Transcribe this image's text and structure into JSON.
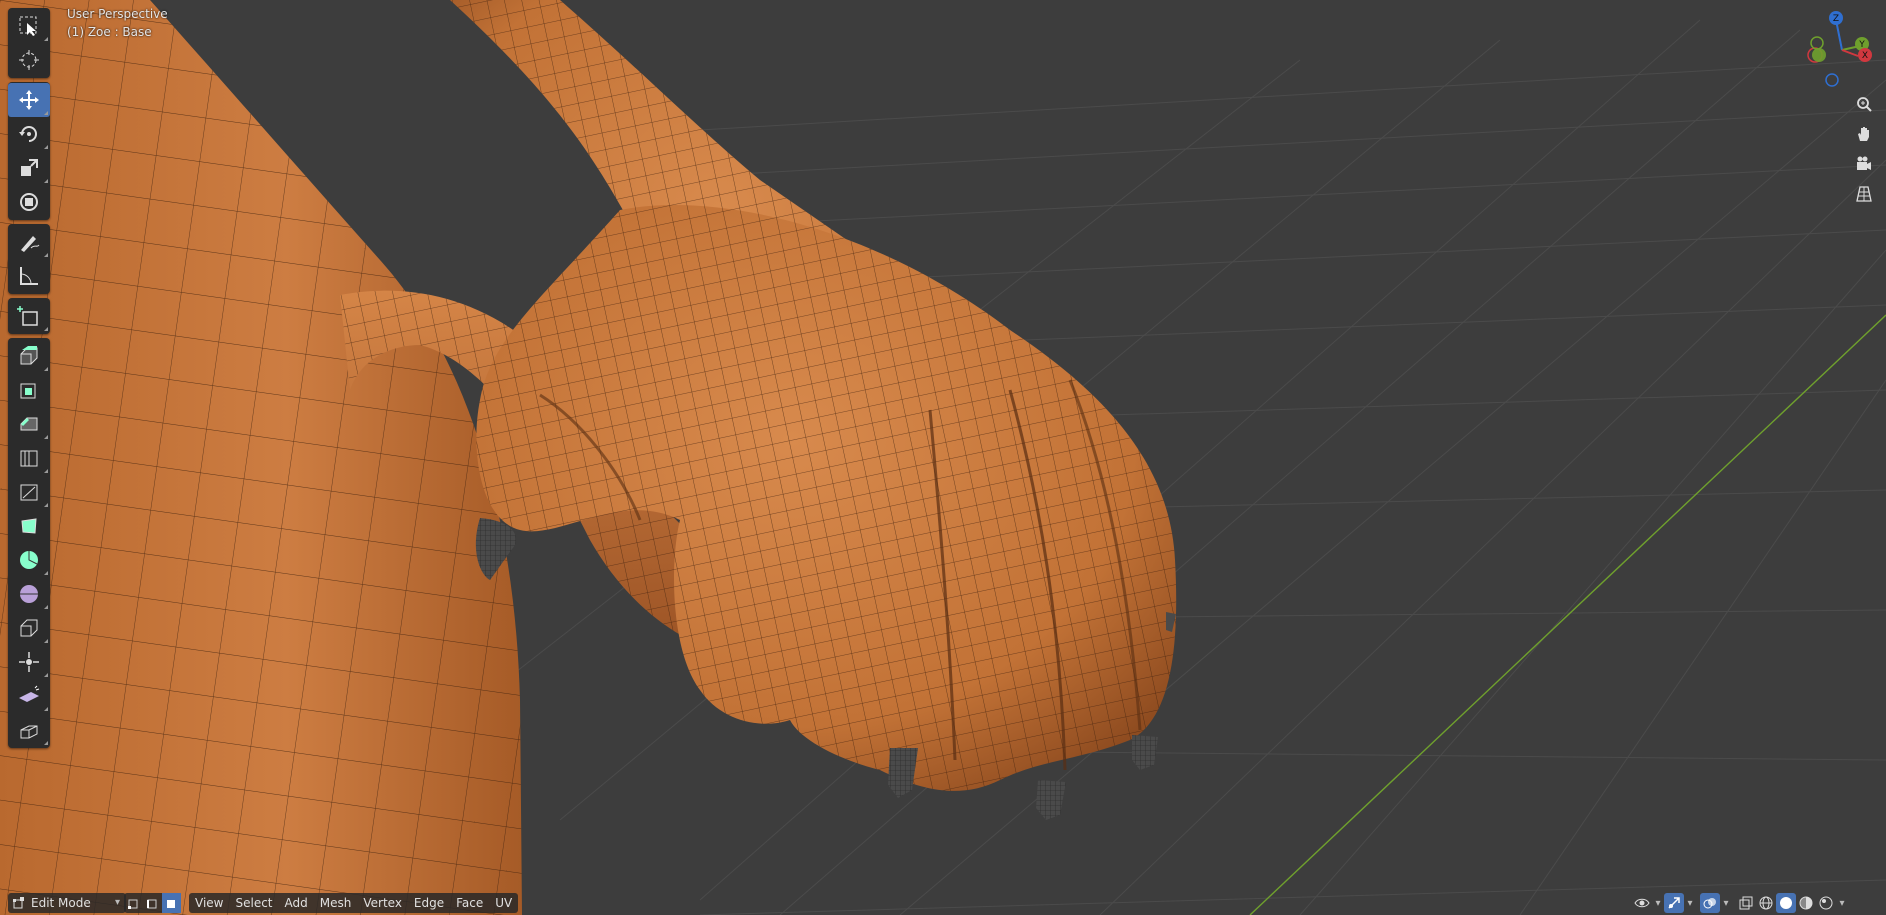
{
  "viewport": {
    "view_name": "User Perspective",
    "object_info": "(1) Zoe : Base",
    "colors": {
      "background": "#3d3d3d",
      "grid": "#4a4a4a",
      "x_axis": "#b23a3a",
      "y_axis": "#6fa02d",
      "skin": "#c8783f",
      "skin_shadow": "#8a4a22",
      "wire": "#3b1e0c",
      "claw": "#444444",
      "active_tool": "#4772b3"
    }
  },
  "toolbar": {
    "tools": [
      {
        "name": "select-box",
        "icon": "select-box-icon",
        "active": false
      },
      {
        "name": "cursor",
        "icon": "cursor-icon",
        "active": false
      },
      {
        "name": "move",
        "icon": "move-icon",
        "active": true
      },
      {
        "name": "rotate",
        "icon": "rotate-icon",
        "active": false
      },
      {
        "name": "scale",
        "icon": "scale-icon",
        "active": false
      },
      {
        "name": "transform",
        "icon": "transform-icon",
        "active": false
      },
      {
        "name": "annotate",
        "icon": "annotate-icon",
        "active": false
      },
      {
        "name": "measure",
        "icon": "measure-icon",
        "active": false
      },
      {
        "name": "add-cube",
        "icon": "add-cube-icon",
        "active": false
      },
      {
        "name": "extrude",
        "icon": "extrude-icon",
        "active": false
      },
      {
        "name": "inset",
        "icon": "inset-icon",
        "active": false
      },
      {
        "name": "bevel",
        "icon": "bevel-icon",
        "active": false
      },
      {
        "name": "loop-cut",
        "icon": "loop-cut-icon",
        "active": false
      },
      {
        "name": "knife",
        "icon": "knife-icon",
        "active": false
      },
      {
        "name": "poly-build",
        "icon": "poly-build-icon",
        "active": false
      },
      {
        "name": "spin",
        "icon": "spin-icon",
        "active": false
      },
      {
        "name": "smooth",
        "icon": "smooth-icon",
        "active": false
      },
      {
        "name": "edge-slide",
        "icon": "edge-slide-icon",
        "active": false
      },
      {
        "name": "shrink-fatten",
        "icon": "shrink-fatten-icon",
        "active": false
      },
      {
        "name": "shear",
        "icon": "shear-icon",
        "active": false
      },
      {
        "name": "rip-region",
        "icon": "rip-region-icon",
        "active": false
      }
    ]
  },
  "gizmo": {
    "axes": [
      {
        "label": "Z",
        "color": "#2f6fd1"
      },
      {
        "label": "Y",
        "color": "#6fa02d"
      },
      {
        "label": "X",
        "color": "#d1383f"
      }
    ]
  },
  "nav_buttons": [
    "zoom-icon",
    "pan-hand-icon",
    "camera-icon",
    "grid-view-icon"
  ],
  "header": {
    "mode": "Edit Mode",
    "menus": [
      "View",
      "Select",
      "Add",
      "Mesh",
      "Vertex",
      "Edge",
      "Face",
      "UV"
    ]
  }
}
